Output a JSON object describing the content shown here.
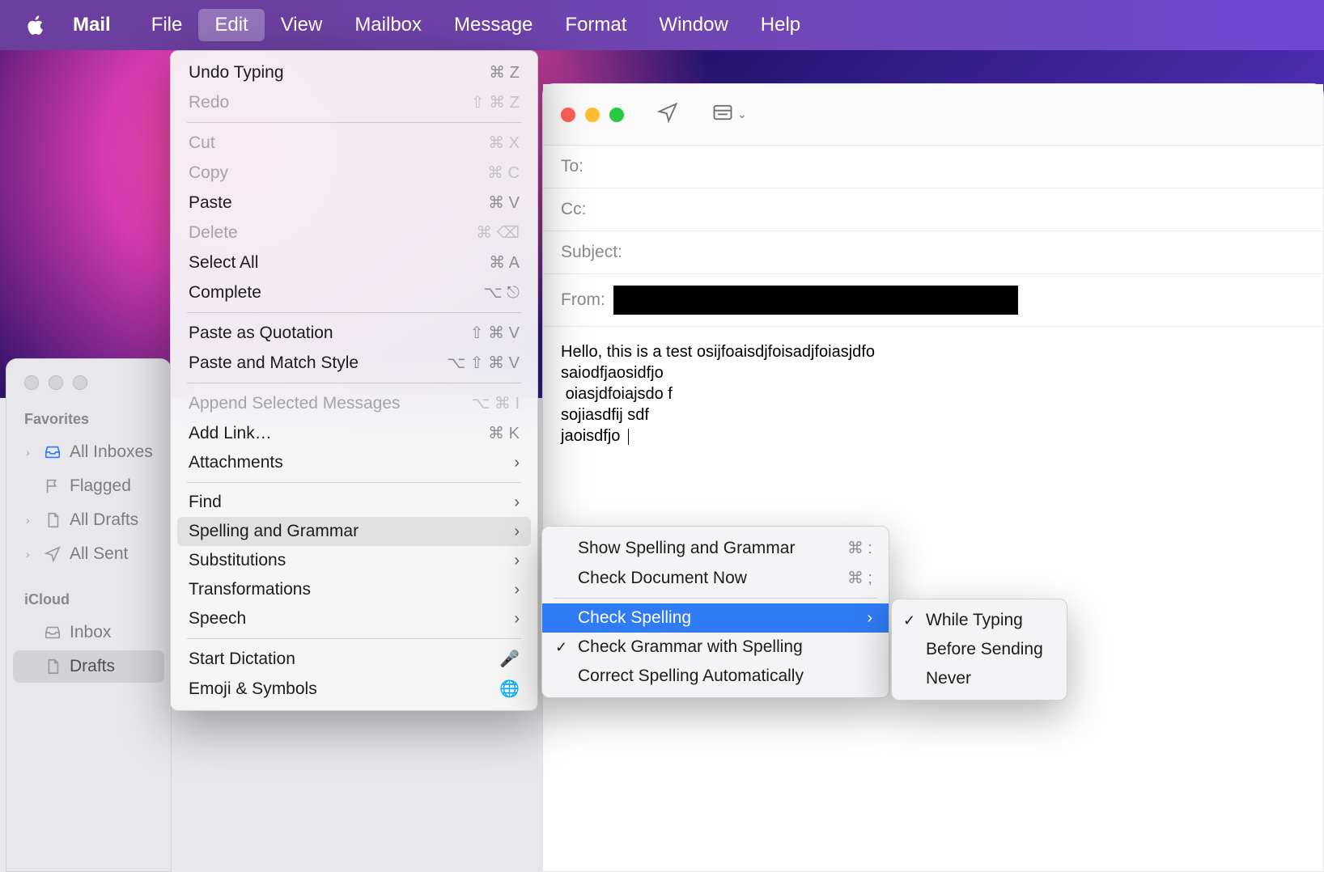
{
  "menubar": {
    "app": "Mail",
    "items": [
      "File",
      "Edit",
      "View",
      "Mailbox",
      "Message",
      "Format",
      "Window",
      "Help"
    ],
    "active": "Edit"
  },
  "edit_menu": [
    {
      "label": "Undo Typing",
      "shortcut": "⌘ Z",
      "enabled": true
    },
    {
      "label": "Redo",
      "shortcut": "⇧ ⌘ Z",
      "enabled": false
    },
    {
      "sep": true
    },
    {
      "label": "Cut",
      "shortcut": "⌘ X",
      "enabled": false
    },
    {
      "label": "Copy",
      "shortcut": "⌘ C",
      "enabled": false
    },
    {
      "label": "Paste",
      "shortcut": "⌘ V",
      "enabled": true
    },
    {
      "label": "Delete",
      "shortcut": "⌘ ⌫",
      "enabled": false
    },
    {
      "label": "Select All",
      "shortcut": "⌘ A",
      "enabled": true
    },
    {
      "label": "Complete",
      "shortcut": "⌥ ⎋",
      "enabled": true
    },
    {
      "sep": true
    },
    {
      "label": "Paste as Quotation",
      "shortcut": "⇧ ⌘ V",
      "enabled": true
    },
    {
      "label": "Paste and Match Style",
      "shortcut": "⌥ ⇧ ⌘ V",
      "enabled": true
    },
    {
      "sep": true
    },
    {
      "label": "Append Selected Messages",
      "shortcut": "⌥ ⌘ I",
      "enabled": false
    },
    {
      "label": "Add Link…",
      "shortcut": "⌘ K",
      "enabled": true
    },
    {
      "label": "Attachments",
      "submenu": true,
      "enabled": true
    },
    {
      "sep": true
    },
    {
      "label": "Find",
      "submenu": true,
      "enabled": true
    },
    {
      "label": "Spelling and Grammar",
      "submenu": true,
      "enabled": true,
      "hover": true
    },
    {
      "label": "Substitutions",
      "submenu": true,
      "enabled": true
    },
    {
      "label": "Transformations",
      "submenu": true,
      "enabled": true
    },
    {
      "label": "Speech",
      "submenu": true,
      "enabled": true
    },
    {
      "sep": true
    },
    {
      "label": "Start Dictation",
      "glyph": "mic",
      "enabled": true
    },
    {
      "label": "Emoji & Symbols",
      "glyph": "globe",
      "enabled": true
    }
  ],
  "spelling_submenu": [
    {
      "label": "Show Spelling and Grammar",
      "shortcut": "⌘ :"
    },
    {
      "label": "Check Document Now",
      "shortcut": "⌘ ;"
    },
    {
      "sep": true
    },
    {
      "label": "Check Spelling",
      "submenu": true,
      "highlight": true
    },
    {
      "label": "Check Grammar with Spelling",
      "checked": true
    },
    {
      "label": "Correct Spelling Automatically"
    }
  ],
  "check_spelling_submenu": [
    {
      "label": "While Typing",
      "checked": true
    },
    {
      "label": "Before Sending"
    },
    {
      "label": "Never"
    }
  ],
  "sidebar": {
    "sections": [
      {
        "label": "Favorites",
        "items": [
          {
            "label": "All Inboxes",
            "icon": "inbox",
            "disclosure": true
          },
          {
            "label": "Flagged",
            "icon": "flag"
          },
          {
            "label": "All Drafts",
            "icon": "doc",
            "disclosure": true
          },
          {
            "label": "All Sent",
            "icon": "paperplane",
            "disclosure": true
          }
        ]
      },
      {
        "label": "iCloud",
        "items": [
          {
            "label": "Inbox",
            "icon": "inbox"
          },
          {
            "label": "Drafts",
            "icon": "doc",
            "selected": true
          }
        ]
      }
    ]
  },
  "compose": {
    "fields": {
      "to_label": "To:",
      "cc_label": "Cc:",
      "subject_label": "Subject:",
      "from_label": "From:"
    },
    "body": "Hello, this is a test osijfoaisdjfoisadjfoiasjdfo\nsaiodfjaosidfjo\n oiasjdfoiajsdo f\nsojiasdfij sdf\njaoisdfjo "
  }
}
